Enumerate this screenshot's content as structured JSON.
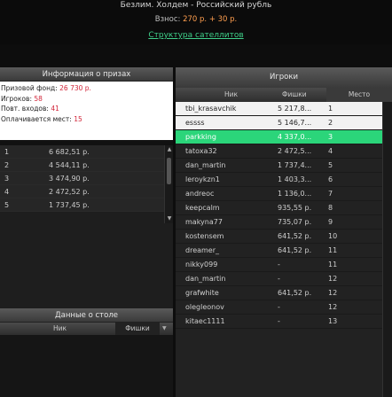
{
  "header": {
    "title": "Безлим. Холдем - Российский рубль",
    "fee_label": "Взнос:",
    "fee_amount": "270 р. + 30 р.",
    "satellite_link": "Структура сателлитов"
  },
  "prize_panel": {
    "title": "Информация о призах",
    "info": [
      {
        "label": "Призовой фонд:",
        "value": "26 730 р."
      },
      {
        "label": "Игроков:",
        "value": "58"
      },
      {
        "label": "Повт. входов:",
        "value": "41"
      },
      {
        "label": "Оплачивается мест:",
        "value": "15"
      }
    ],
    "rows": [
      {
        "place": "1",
        "amount": "6 682,51 р."
      },
      {
        "place": "2",
        "amount": "4 544,11 р."
      },
      {
        "place": "3",
        "amount": "3 474,90 р."
      },
      {
        "place": "4",
        "amount": "2 472,52 р."
      },
      {
        "place": "5",
        "amount": "1 737,45 р."
      }
    ]
  },
  "table_data": {
    "title": "Данные о столе",
    "col_name": "Ник",
    "col_chips": "Фишки"
  },
  "players_panel": {
    "title": "Игроки",
    "col_name": "Ник",
    "col_chips": "Фишки",
    "col_place": "Место",
    "rows": [
      {
        "name": "tbi_krasavchik",
        "chips": "5 217,8...",
        "place": "1",
        "style": "light"
      },
      {
        "name": "essss",
        "chips": "5 146,7...",
        "place": "2",
        "style": "light"
      },
      {
        "name": "parkking",
        "chips": "4 337,0...",
        "place": "3",
        "style": "green"
      },
      {
        "name": "tatoxa32",
        "chips": "2 472,5...",
        "place": "4",
        "style": "dark"
      },
      {
        "name": "dan_martin",
        "chips": "1 737,4...",
        "place": "5",
        "style": "dark"
      },
      {
        "name": "leroykzn1",
        "chips": "1 403,3...",
        "place": "6",
        "style": "dark"
      },
      {
        "name": "andreoc",
        "chips": "1 136,0...",
        "place": "7",
        "style": "dark"
      },
      {
        "name": "keepcalm",
        "chips": "935,55 р.",
        "place": "8",
        "style": "dark"
      },
      {
        "name": "makyna77",
        "chips": "735,07 р.",
        "place": "9",
        "style": "dark"
      },
      {
        "name": "kostensem",
        "chips": "641,52 р.",
        "place": "10",
        "style": "dark"
      },
      {
        "name": "dreamer_",
        "chips": "641,52 р.",
        "place": "11",
        "style": "dark"
      },
      {
        "name": "nikky099",
        "chips": "-",
        "place": "11",
        "style": "dark"
      },
      {
        "name": "dan_martin",
        "chips": "-",
        "place": "12",
        "style": "dark"
      },
      {
        "name": "grafwhite",
        "chips": "641,52 р.",
        "place": "12",
        "style": "dark"
      },
      {
        "name": "olegleonov",
        "chips": "-",
        "place": "12",
        "style": "dark"
      },
      {
        "name": "kitaec1111",
        "chips": "-",
        "place": "13",
        "style": "dark"
      }
    ]
  },
  "colors": {
    "accent_link": "#3fd08a",
    "highlight_row": "#2bd57a",
    "fee_amount": "#ff9f4f",
    "info_value": "#d2263a"
  },
  "icons": [
    "sort-down-icon",
    "scroll-up-icon",
    "scroll-down-icon"
  ]
}
